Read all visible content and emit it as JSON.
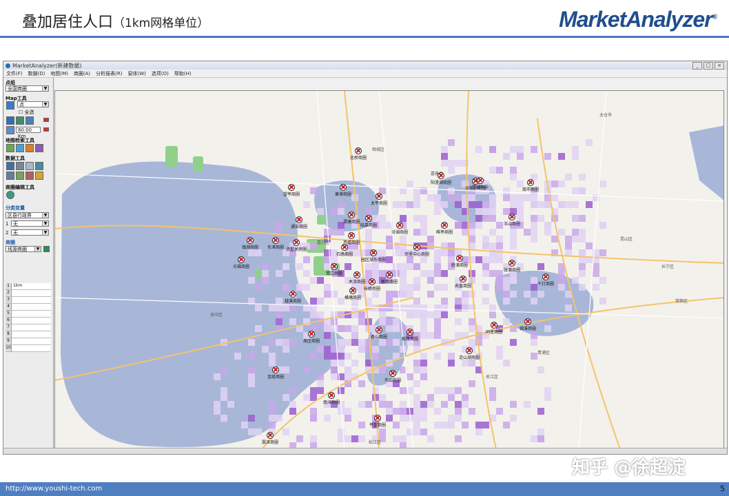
{
  "slide": {
    "title": "叠加居住人口",
    "subtitle": "（1km网格单位）",
    "brand": "MarketAnalyzer",
    "brand_mark": "®",
    "footer_url": "http://www.youshi-tech.com",
    "page_number": "5",
    "watermark": "知乎 @徐超淀"
  },
  "window": {
    "title": "MarketAnalyzer(新建数据)",
    "buttons": [
      "_",
      "□",
      "×"
    ],
    "menu": [
      "文件(F)",
      "数据(D)",
      "地图(M)",
      "商圈(A)",
      "分析报表(R)",
      "窗体(W)",
      "选项(O)",
      "帮助(H)"
    ]
  },
  "left_panel": {
    "point_group_label": "点组",
    "point_group_value": "全国商圈",
    "map_tools_label": "Map工具",
    "map_tool_mode": "点",
    "select_all_label": "全选",
    "scale_value": "80.00",
    "scale_unit": "Km",
    "map_search_label": "地图检索工具",
    "data_tools_label": "数据工具",
    "trade_area_edit_label": "商圈编辑工具",
    "classification_label": "分类变量",
    "classification_value": "区县行政界",
    "var1_index": "1",
    "var1_value": "无",
    "var2_index": "2",
    "var2_value": "无",
    "trade_area_label": "商圈",
    "trade_area_value": "线源商圈",
    "list_rows": [
      {
        "n": "1",
        "v": "1km"
      },
      {
        "n": "2",
        "v": ""
      },
      {
        "n": "3",
        "v": ""
      },
      {
        "n": "4",
        "v": ""
      },
      {
        "n": "5",
        "v": ""
      },
      {
        "n": "6",
        "v": ""
      },
      {
        "n": "7",
        "v": ""
      },
      {
        "n": "8",
        "v": ""
      },
      {
        "n": "9",
        "v": ""
      },
      {
        "n": "10",
        "v": ""
      }
    ]
  },
  "map": {
    "places": [
      "太仓市",
      "昆山区",
      "吴中区",
      "青浦区",
      "嘉兴区",
      "松江区",
      "长宁区",
      "嘉善县",
      "吴江区",
      "相城区",
      "常熟区"
    ],
    "pois": [
      "北桥商圈",
      "黄埭商圈",
      "太平商圈",
      "阳澄湖商圈",
      "沙家浜商圈",
      "昆城商圈",
      "周市商圈",
      "望亭商圈",
      "通安商圈",
      "渭塘商圈",
      "陆慕商圈",
      "玉山商圈",
      "镇湖商圈",
      "东渚商圈",
      "浒墅关商圈",
      "石路商圈",
      "园区湖东商圈",
      "光福商圈",
      "胥口商圈",
      "木渎商圈",
      "横塘商圈",
      "长桥商圈",
      "邻里中心商圈",
      "胜浦商圈",
      "张浦商圈",
      "千灯商圈",
      "唯亭商圈",
      "甪直商圈",
      "郭巷商圈",
      "越溪商圈",
      "香山商圈",
      "松陵商圈",
      "同里商圈",
      "锦溪商圈",
      "淀山湖商圈",
      "周庄商圈",
      "金庭商圈",
      "东山商圈",
      "南浔商圈",
      "盛泽商圈",
      "平望商圈",
      "震泽商圈",
      "七都商圈",
      "黎里商圈",
      "芦墟商圈",
      "汾湖商圈"
    ]
  }
}
